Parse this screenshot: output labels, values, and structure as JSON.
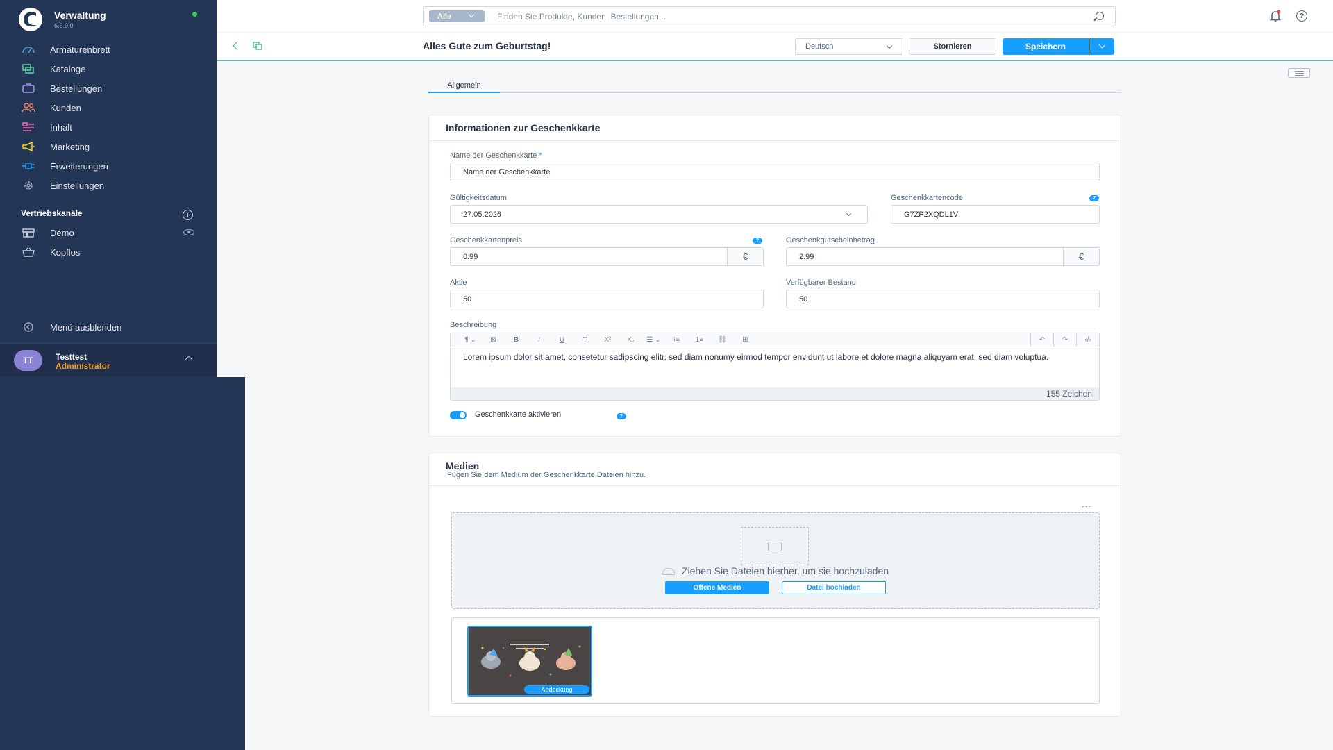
{
  "app": {
    "title": "Verwaltung",
    "version": "6.6.9.0",
    "status_color": "#37d046"
  },
  "sidebar": {
    "items": [
      {
        "label": "Armaturenbrett",
        "icon": "gauge-icon",
        "color": "#4a9ad6"
      },
      {
        "label": "Kataloge",
        "icon": "catalog-icon",
        "color": "#57d9a3"
      },
      {
        "label": "Bestellungen",
        "icon": "shopping-bag-icon",
        "color": "#a092f0"
      },
      {
        "label": "Kunden",
        "icon": "users-icon",
        "color": "#f88962"
      },
      {
        "label": "Inhalt",
        "icon": "content-icon",
        "color": "#ff68b4"
      },
      {
        "label": "Marketing",
        "icon": "megaphone-icon",
        "color": "#ffd700"
      },
      {
        "label": "Erweiterungen",
        "icon": "plug-icon",
        "color": "#189eff"
      },
      {
        "label": "Einstellungen",
        "icon": "gear-icon",
        "color": "#9aa8b5"
      }
    ],
    "sales_channels_title": "Vertriebskanäle",
    "channels": [
      {
        "label": "Demo",
        "icon": "storefront-icon"
      },
      {
        "label": "Kopflos",
        "icon": "basket-icon"
      }
    ],
    "hide_menu_label": "Menü ausblenden",
    "user": {
      "initials": "TT",
      "name": "Testtest",
      "role": "Administrator"
    }
  },
  "header": {
    "search_type": "Alle",
    "search_placeholder": "Finden Sie Produkte, Kunden, Bestellungen..."
  },
  "smartbar": {
    "title": "Alles Gute zum Geburtstag!",
    "language": "Deutsch",
    "cancel_label": "Stornieren",
    "save_label": "Speichern"
  },
  "tabs": [
    {
      "label": "Allgemein",
      "active": true
    }
  ],
  "info_card": {
    "title": "Informationen zur Geschenkkarte",
    "name_label": "Name der Geschenkkarte",
    "required_mark": "*",
    "name_value": "Name der Geschenkkarte",
    "valid_until_label": "Gültigkeitsdatum",
    "valid_until_value": "27.05.2026",
    "code_label": "Geschenkkartencode",
    "code_value": "G7ZP2XQDL1V",
    "price_label": "Geschenkkartenpreis",
    "price_value": "0.99",
    "voucher_label": "Geschenkgutscheinbetrag",
    "voucher_value": "2.99",
    "currency": "€",
    "stock_label": "Aktie",
    "stock_value": "50",
    "available_label": "Verfügbarer Bestand",
    "available_value": "50",
    "description_label": "Beschreibung",
    "description_text": "Lorem ipsum dolor sit amet, consetetur sadipscing elitr, sed diam nonumy eirmod tempor envidunt ut labore et dolore magna aliquyam erat, sed diam voluptua.",
    "char_count": "155 Zeichen",
    "activate_label": "Geschenkkarte aktivieren",
    "activate_enabled": true,
    "help_glyph": "?"
  },
  "editor_toolbar": [
    "¶ ⌄",
    "⊠",
    "B",
    "I",
    "U",
    "T",
    "X²",
    "X₂",
    "☰ ⌄",
    "⁝≡",
    "1≡",
    "⛓",
    "⊞"
  ],
  "editor_toolbar_right": [
    "↶",
    "↷",
    "‹/›"
  ],
  "media_card": {
    "title": "Medien",
    "subtitle": "Fügen Sie dem Medium der Geschenkkarte Dateien hinzu.",
    "more": "...",
    "drop_text": "Ziehen Sie Dateien hierher, um sie hochzuladen",
    "open_media_label": "Offene Medien",
    "upload_label": "Datei hochladen",
    "cover_label": "Abdeckung"
  }
}
